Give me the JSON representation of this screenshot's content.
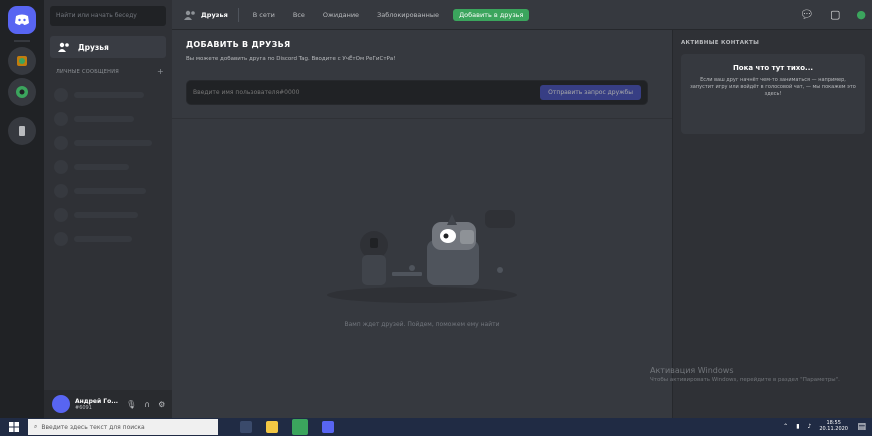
{
  "rail": {
    "home_icon": "discord-logo-icon",
    "servers": [
      "server-1",
      "server-2",
      "server-3"
    ]
  },
  "sidebar": {
    "search_placeholder": "Найти или начать беседу",
    "friends_label": "Друзья",
    "dm_header": "ЛИЧНЫЕ СООБЩЕНИЯ",
    "dm_add": "+"
  },
  "user": {
    "name": "Андрей Го...",
    "tag": "#6091",
    "icons": [
      "microphone-icon",
      "headphones-icon",
      "gear-icon"
    ]
  },
  "topbar": {
    "title": "Друзья",
    "tabs": [
      "В сети",
      "Все",
      "Ожидание",
      "Заблокированные"
    ],
    "add_friend": "Добавить в друзья",
    "right_icons": [
      "new-group-dm-icon",
      "inbox-icon",
      "help-icon"
    ]
  },
  "main": {
    "heading": "ДОБАВИТЬ В ДРУЗЬЯ",
    "subtitle": "Вы можете добавить друга по Discord Tag. Вводите с УчЁтОм РеГиСтРа!",
    "input_placeholder": "Введите имя пользователя#0000",
    "send_button": "Отправить запрос дружбы",
    "empty_text": "Вамп ждет друзей. Пойдем, поможем ему найти"
  },
  "rpanel": {
    "heading": "АКТИВНЫЕ КОНТАКТЫ",
    "box_title": "Пока что тут тихо...",
    "box_desc": "Если ваш друг начнёт чем-то заниматься — например, запустит игру или войдёт в голосовой чат, — мы покажем это здесь!"
  },
  "watermark": {
    "title": "Активация Windows",
    "desc": "Чтобы активировать Windows, перейдите в раздел \"Параметры\"."
  },
  "taskbar": {
    "search_placeholder": "Введите здесь текст для поиска",
    "time": "18:55",
    "date": "20.11.2020"
  },
  "colors": {
    "blurple": "#5865f2",
    "green": "#3ba55d",
    "bg_main": "#36393f",
    "bg_side": "#2f3136",
    "bg_rail": "#202225"
  }
}
